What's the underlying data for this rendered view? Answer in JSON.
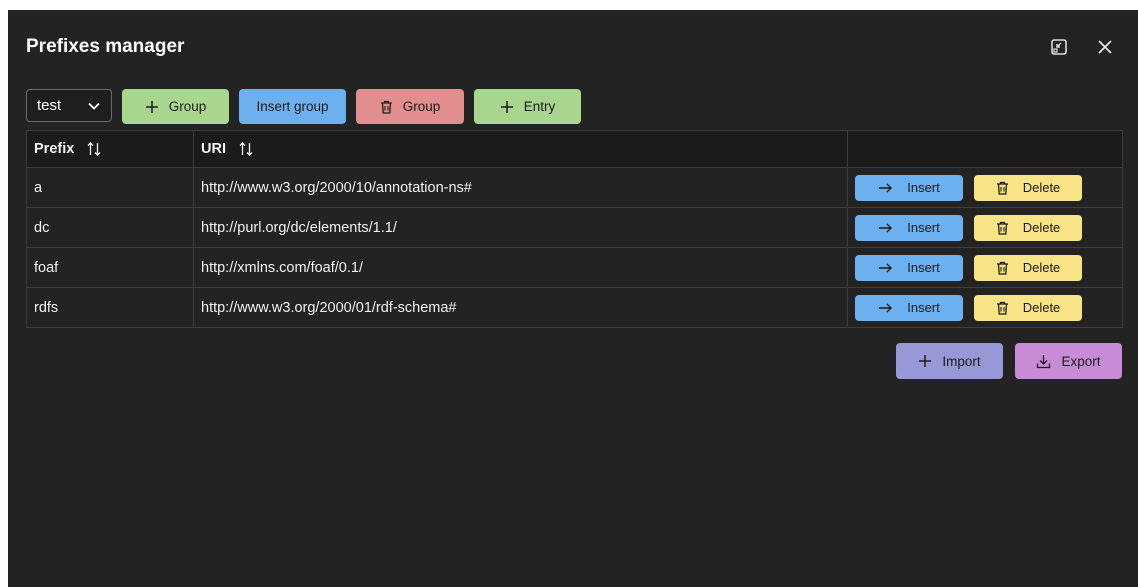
{
  "dialog": {
    "title": "Prefixes manager"
  },
  "toolbar": {
    "group_select_value": "test",
    "add_group_label": "Group",
    "insert_group_label": "Insert group",
    "delete_group_label": "Group",
    "add_entry_label": "Entry"
  },
  "table": {
    "columns": [
      "Prefix",
      "URI",
      ""
    ],
    "rows": [
      {
        "prefix": "a",
        "uri": "http://www.w3.org/2000/10/annotation-ns#"
      },
      {
        "prefix": "dc",
        "uri": "http://purl.org/dc/elements/1.1/"
      },
      {
        "prefix": "foaf",
        "uri": "http://xmlns.com/foaf/0.1/"
      },
      {
        "prefix": "rdfs",
        "uri": "http://www.w3.org/2000/01/rdf-schema#"
      }
    ],
    "insert_label": "Insert",
    "delete_label": "Delete"
  },
  "footer": {
    "import_label": "Import",
    "export_label": "Export"
  },
  "colors": {
    "background": "#232323",
    "green": "#a9d68e",
    "blue": "#6cb0ef",
    "red": "#e38e8e",
    "yellow": "#f8e486",
    "purple": "#9998d6",
    "pink": "#c88bd6"
  },
  "icons": {
    "minimize": "minimize-icon",
    "close": "close-icon",
    "chevron": "chevron-down-icon",
    "plus": "plus-icon",
    "trash": "trash-icon",
    "arrow": "arrow-right-icon",
    "download": "download-icon",
    "sort": "sort-icon"
  }
}
